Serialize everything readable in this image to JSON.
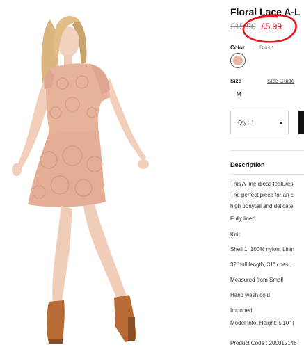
{
  "product": {
    "title": "Floral Lace A-L",
    "price_original": "£15.90",
    "price_sale": "£5.99",
    "color_label": "Color",
    "color_separator": ":",
    "color_value": "Blush",
    "swatch_color": "#e7b7a3",
    "size_label": "Size",
    "size_guide_label": "Size Guide",
    "size_options": [
      "M"
    ],
    "qty_label": "Qty : 1",
    "description_heading": "Description",
    "description_lines": [
      "This A-line dress features",
      "The perfect piece for an c",
      "high ponytail and delicate"
    ],
    "details": [
      "Fully lined",
      "Knit",
      "Shell 1: 100% nylon; Linin",
      "32\" full length, 31\" chest,",
      "Measured from Small",
      "Hand wash cold",
      "Imported",
      "Model Info: Height: 5'10\" |",
      "Product Code : 200012146"
    ]
  },
  "annotation": {
    "color": "#e8141c",
    "shape": "hand-drawn circle around sale price"
  }
}
